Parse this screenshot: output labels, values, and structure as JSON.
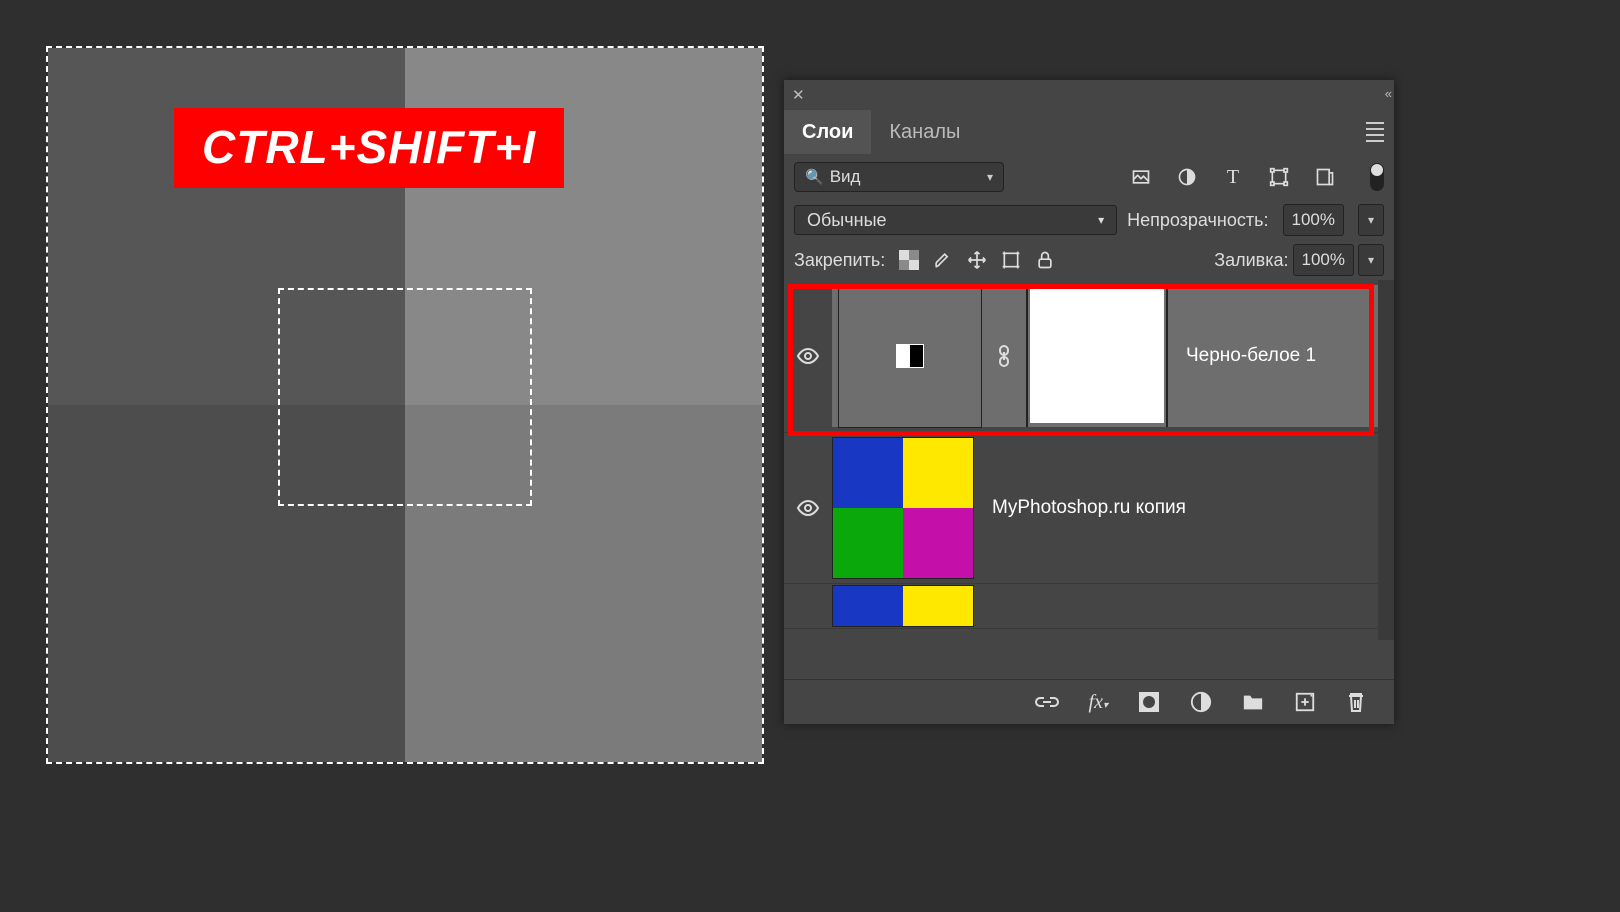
{
  "overlay": {
    "shortcut": "CTRL+SHIFT+I"
  },
  "panel": {
    "tabs": {
      "layers": "Слои",
      "channels": "Каналы"
    },
    "search": {
      "label": "Вид"
    },
    "blend_mode": {
      "value": "Обычные"
    },
    "opacity": {
      "label": "Непрозрачность:",
      "value": "100%"
    },
    "lock": {
      "label": "Закрепить:"
    },
    "fill": {
      "label": "Заливка:",
      "value": "100%"
    },
    "layers_list": {
      "layer1": {
        "name": "Черно-белое 1"
      },
      "layer2": {
        "name": "MyPhotoshop.ru копия"
      }
    }
  }
}
